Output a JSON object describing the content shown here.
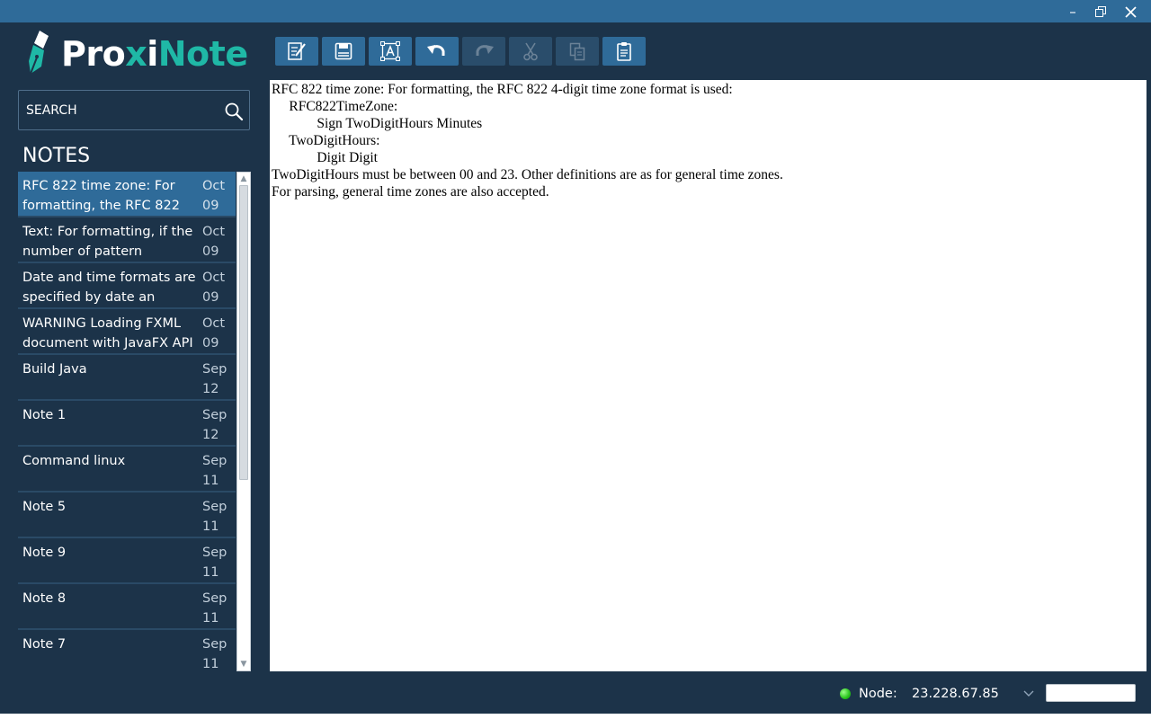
{
  "app": {
    "logo_text_a": "Pro",
    "logo_text_x": "x",
    "logo_text_b": "i",
    "logo_text_c": "Note",
    "window_controls": [
      "minimize-icon",
      "restore-icon",
      "close-icon"
    ]
  },
  "colors": {
    "titlebar": "#2f6b99",
    "background": "#1c3349",
    "accent": "#1fb8a6",
    "selected_note": "#2f6b99",
    "toolbar_button": "#2f6b99",
    "toolbar_button_disabled": "#2a4d6b",
    "status_online": "#27c41b"
  },
  "search": {
    "placeholder": "SEARCH",
    "value": "",
    "icon": "search-icon"
  },
  "notes_header": "NOTES",
  "notes": [
    {
      "title": "RFC 822 time zone: For formatting, the RFC 822",
      "date": "Oct\n09",
      "selected": true
    },
    {
      "title": "Text: For formatting, if the number of pattern",
      "date": "Oct\n09",
      "selected": false
    },
    {
      "title": "Date and time formats are specified by date an",
      "date": "Oct\n09",
      "selected": false
    },
    {
      "title": "WARNING Loading FXML document with JavaFX API",
      "date": "Oct\n09",
      "selected": false
    },
    {
      "title": "Build Java",
      "date": "Sep\n12",
      "selected": false
    },
    {
      "title": "Note 1",
      "date": "Sep\n12",
      "selected": false
    },
    {
      "title": "Command linux",
      "date": "Sep\n11",
      "selected": false
    },
    {
      "title": "Note 5",
      "date": "Sep\n11",
      "selected": false
    },
    {
      "title": "Note 9",
      "date": "Sep\n11",
      "selected": false
    },
    {
      "title": "Note 8",
      "date": "Sep\n11",
      "selected": false
    },
    {
      "title": "Note 7",
      "date": "Sep\n11",
      "selected": false
    }
  ],
  "toolbar": [
    {
      "name": "new-note-button",
      "icon": "edit-note-icon",
      "enabled": true
    },
    {
      "name": "save-button",
      "icon": "save-icon",
      "enabled": true
    },
    {
      "name": "font-button",
      "icon": "text-format-icon",
      "enabled": true
    },
    {
      "name": "undo-button",
      "icon": "undo-icon",
      "enabled": true
    },
    {
      "name": "redo-button",
      "icon": "redo-icon",
      "enabled": false
    },
    {
      "name": "cut-button",
      "icon": "cut-icon",
      "enabled": false
    },
    {
      "name": "copy-button",
      "icon": "copy-icon",
      "enabled": false
    },
    {
      "name": "paste-button",
      "icon": "paste-icon",
      "enabled": true
    }
  ],
  "editor": {
    "content": "RFC 822 time zone: For formatting, the RFC 822 4-digit time zone format is used:\n     RFC822TimeZone:\n             Sign TwoDigitHours Minutes\n     TwoDigitHours:\n             Digit Digit\nTwoDigitHours must be between 00 and 23. Other definitions are as for general time zones.\nFor parsing, general time zones are also accepted."
  },
  "status": {
    "node_label": "Node:",
    "node_value": "23.228.67.85",
    "node_status": "online",
    "extra_input_value": ""
  }
}
